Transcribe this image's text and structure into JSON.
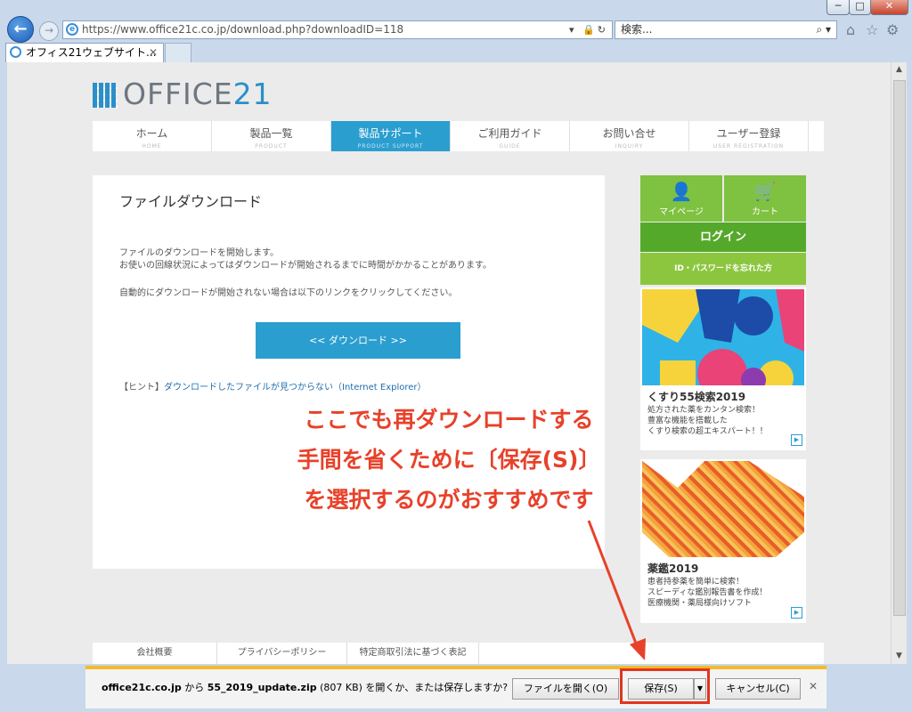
{
  "browser": {
    "address_url": "https://www.office21c.co.jp/download.php?downloadID=118",
    "search_placeholder": "検索...",
    "tab_title": "オフィス21ウェブサイト...",
    "window_buttons": [
      "─",
      "□",
      "✕"
    ]
  },
  "site": {
    "logo_text_a": "OFFICE",
    "logo_text_b": "21",
    "menu": [
      {
        "jp": "ホーム",
        "en": "HOME"
      },
      {
        "jp": "製品一覧",
        "en": "PRODUCT"
      },
      {
        "jp": "製品サポート",
        "en": "PRODUCT SUPPORT"
      },
      {
        "jp": "ご利用ガイド",
        "en": "GUIDE"
      },
      {
        "jp": "お問い合せ",
        "en": "INQUIRY"
      },
      {
        "jp": "ユーザー登録",
        "en": "USER REGISTRATION"
      }
    ]
  },
  "main": {
    "title": "ファイルダウンロード",
    "line1": "ファイルのダウンロードを開始します。",
    "line2": "お使いの回線状況によってはダウンロードが開始されるまでに時間がかかることがあります。",
    "line3": "自動的にダウンロードが開始されない場合は以下のリンクをクリックしてください。",
    "download_button": "<< ダウンロード >>",
    "hint_prefix": "【ヒント】",
    "hint_link": "ダウンロードしたファイルが見つからない（Internet Explorer）"
  },
  "sidebar": {
    "mypage": "マイページ",
    "cart": "カート",
    "login": "ログイン",
    "forgot": "ID・パスワードを忘れた方",
    "banner1": {
      "title": "くすり55検索2019",
      "desc1": "処方された薬をカンタン検索！",
      "desc2": "豊富な機能を搭載した",
      "desc3": "くすり検索の超エキスパート！！"
    },
    "banner2": {
      "title": "薬鑑2019",
      "desc1": "患者持参薬を簡単に検索！",
      "desc2": "スピーディな鑑別報告書を作成！",
      "desc3": "医療機関・薬局様向けソフト"
    }
  },
  "footer": [
    "会社概要",
    "プライバシーポリシー",
    "特定商取引法に基づく表記"
  ],
  "annotation": {
    "line1": "ここでも再ダウンロードする",
    "line2": "手間を省くために〔保存(S)〕",
    "line3": "を選択するのがおすすめです"
  },
  "download_bar": {
    "host": "office21c.co.jp",
    "from": " から ",
    "file": "55_2019_update.zip",
    "size": " (807 KB) ",
    "question": "を開くか、または保存しますか?",
    "open_button": "ファイルを開く(O)",
    "save_button": "保存(S)",
    "cancel_button": "キャンセル(C)"
  },
  "colors": {
    "accent_blue": "#2b9ed0",
    "green": "#7fc140",
    "annotation_red": "#e8412a",
    "highlight_box": "#e03520",
    "download_bar_top": "#f2bb2a"
  }
}
